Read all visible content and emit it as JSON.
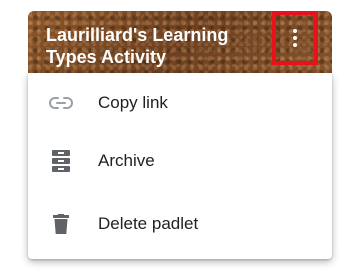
{
  "card": {
    "title": "Laurilliard's Learning Types Activity",
    "menu_icon": "more-vertical-icon"
  },
  "menu": {
    "items": [
      {
        "label": "Copy link",
        "icon": "link-icon"
      },
      {
        "label": "Archive",
        "icon": "archive-icon"
      },
      {
        "label": "Delete padlet",
        "icon": "trash-icon"
      }
    ]
  },
  "colors": {
    "highlight": "#e8131a",
    "card_bg": "#7a4a24",
    "icon_gray": "#9aa0a6",
    "icon_dark": "#5f6368",
    "text": "#202124"
  }
}
